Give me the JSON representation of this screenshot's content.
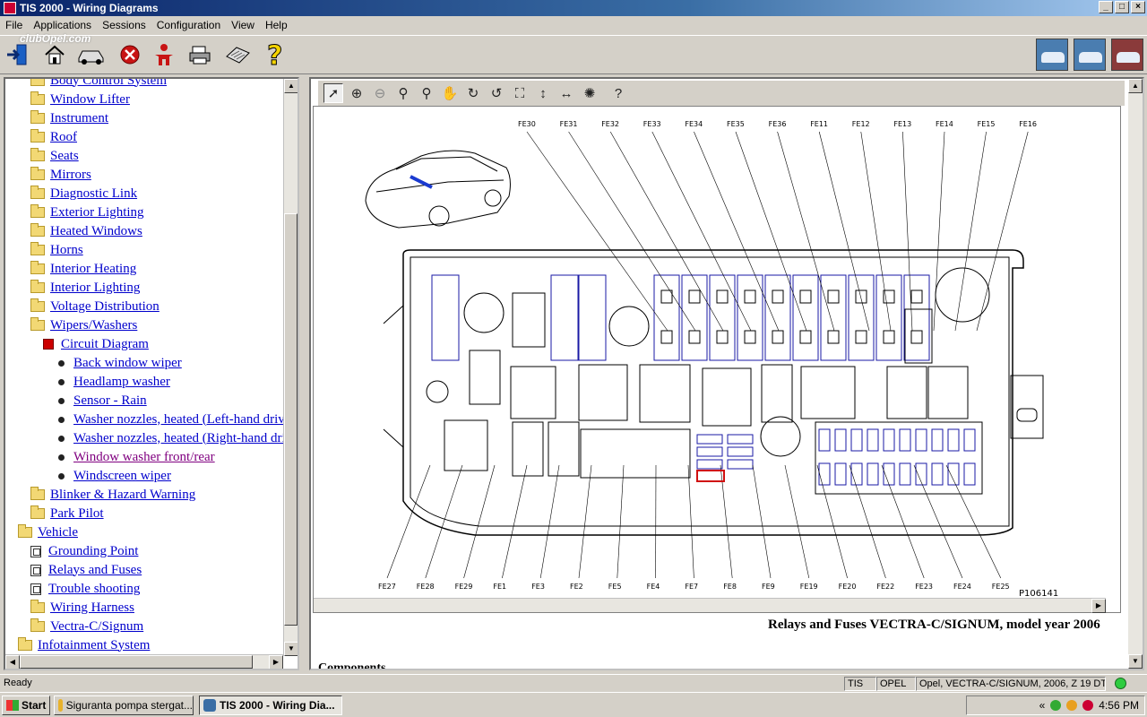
{
  "window": {
    "title": "TIS 2000 - Wiring Diagrams",
    "overlay_logo": "clubOpel.com"
  },
  "menu": [
    "File",
    "Applications",
    "Sessions",
    "Configuration",
    "View",
    "Help"
  ],
  "tree": {
    "items": [
      {
        "label": "Body Control System",
        "icon": "folder"
      },
      {
        "label": "Window Lifter",
        "icon": "folder"
      },
      {
        "label": "Instrument",
        "icon": "folder"
      },
      {
        "label": "Roof",
        "icon": "folder"
      },
      {
        "label": "Seats",
        "icon": "folder"
      },
      {
        "label": "Mirrors",
        "icon": "folder"
      },
      {
        "label": "Diagnostic Link",
        "icon": "folder"
      },
      {
        "label": "Exterior Lighting",
        "icon": "folder"
      },
      {
        "label": "Heated Windows",
        "icon": "folder"
      },
      {
        "label": "Horns",
        "icon": "folder"
      },
      {
        "label": "Interior Heating",
        "icon": "folder"
      },
      {
        "label": "Interior Lighting",
        "icon": "folder"
      },
      {
        "label": "Voltage Distribution",
        "icon": "folder"
      },
      {
        "label": "Wipers/Washers",
        "icon": "folder-open"
      },
      {
        "label": "Circuit Diagram",
        "icon": "book"
      },
      {
        "label": "Back window wiper",
        "icon": "bullet"
      },
      {
        "label": "Headlamp washer",
        "icon": "bullet"
      },
      {
        "label": "Sensor - Rain",
        "icon": "bullet"
      },
      {
        "label": "Washer nozzles, heated (Left-hand driv",
        "icon": "bullet"
      },
      {
        "label": "Washer nozzles, heated (Right-hand dri",
        "icon": "bullet"
      },
      {
        "label": "Window washer front/rear",
        "icon": "bullet",
        "visited": true
      },
      {
        "label": "Windscreen wiper",
        "icon": "bullet"
      },
      {
        "label": "Blinker & Hazard Warning",
        "icon": "folder"
      },
      {
        "label": "Park Pilot",
        "icon": "folder"
      },
      {
        "label": "Vehicle",
        "icon": "folder-open"
      },
      {
        "label": "Grounding Point",
        "icon": "doc"
      },
      {
        "label": "Relays and Fuses",
        "icon": "doc"
      },
      {
        "label": "Trouble shooting",
        "icon": "doc"
      },
      {
        "label": "Wiring Harness",
        "icon": "folder"
      },
      {
        "label": "Vectra-C/Signum",
        "icon": "folder"
      },
      {
        "label": "Infotainment System",
        "icon": "folder"
      }
    ]
  },
  "diagram": {
    "top_labels": [
      "FE30",
      "FE31",
      "FE32",
      "FE33",
      "FE34",
      "FE35",
      "FE36",
      "FE11",
      "FE12",
      "FE13",
      "FE14",
      "FE15",
      "FE16"
    ],
    "bottom_labels": [
      "FE27",
      "FE28",
      "FE29",
      "FE1",
      "FE3",
      "FE2",
      "FE5",
      "FE4",
      "FE7",
      "FE8",
      "FE9",
      "FE19",
      "FE20",
      "FE22",
      "FE23",
      "FE24",
      "FE25"
    ],
    "ref_code": "P106141",
    "caption": "Relays and Fuses VECTRA-C/SIGNUM, model year 2006",
    "components_heading": "Components"
  },
  "status": {
    "left": "Ready",
    "cells": [
      "TIS",
      "OPEL",
      "Opel, VECTRA-C/SIGNUM, 2006, Z 19 DTL"
    ],
    "indicator_color": "#2ecc40"
  },
  "taskbar": {
    "start": "Start",
    "tasks": [
      "Siguranta pompa stergat...",
      "TIS 2000 - Wiring Dia..."
    ],
    "clock": "4:56 PM"
  },
  "colors": {
    "link": "#0000cc",
    "visited": "#800080",
    "fuse_blue": "#1a1aa6",
    "highlight_red": "#d01010"
  }
}
